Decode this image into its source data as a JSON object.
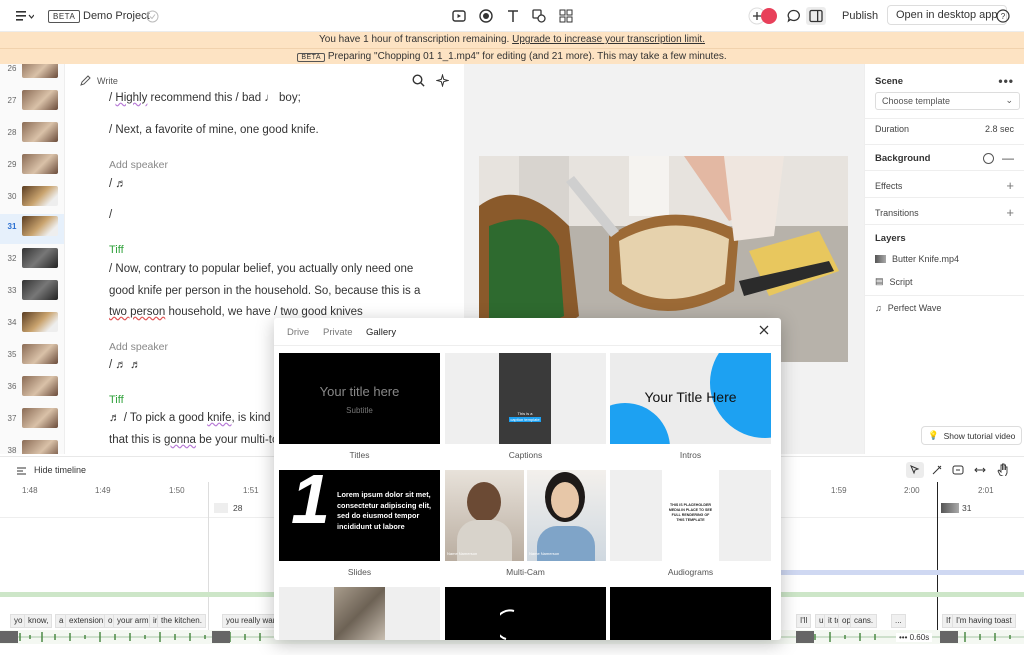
{
  "topbar": {
    "badge": "BETA",
    "project_name": "Demo Project",
    "publish": "Publish",
    "open_desktop": "Open in desktop app",
    "help": "?"
  },
  "banner1": {
    "text": "You have 1 hour of transcription remaining.",
    "link": "Upgrade to increase your transcription limit."
  },
  "banner2": {
    "badge": "BETA",
    "text": "Preparing \"Chopping 01 1_1.mp4\" for editing (and 21 more). This may take a few minutes."
  },
  "thumbs": [
    "26",
    "27",
    "28",
    "29",
    "30",
    "31",
    "32",
    "33",
    "34",
    "35",
    "36",
    "37",
    "38"
  ],
  "thumbs_active": "31",
  "transcript": {
    "write": "Write",
    "lines": {
      "l1_a": "/ ",
      "l1_b": "Highly",
      "l1_c": " recommend this / bad ♩ boy;",
      "l2": "/ Next, a favorite of mine, one good knife.",
      "add_speaker_1": "Add speaker",
      "l3": "/ ♬",
      "l4": "/",
      "speaker_tiff_1": "Tiff",
      "l5": "/ Now, contrary to popular belief, you actually only need one",
      "l6": "good knife per person in the household. So, because this is a",
      "l7_a": "two person",
      "l7_b": " household, we have / two good knives",
      "add_speaker_2": "Add speaker",
      "l8": "/ ♬  ♬",
      "speaker_tiff_2": "Tiff",
      "l9_a": "♬   / To pick a good ",
      "l9_b": "knife",
      "l9_c": ", is kind",
      "l10_a": "that this is ",
      "l10_b": "gonna",
      "l10_c": " be your multi-to"
    }
  },
  "props": {
    "scene": "Scene",
    "choose_template": "Choose template",
    "duration_label": "Duration",
    "duration_value": "2.8 sec",
    "background": "Background",
    "effects": "Effects",
    "transitions": "Transitions",
    "layers": "Layers",
    "layer1": "Butter Knife.mp4",
    "layer2": "Script",
    "layer3": "Perfect Wave",
    "tutorial": "Show tutorial video"
  },
  "timeline": {
    "hide": "Hide timeline",
    "ticks": [
      "1:48",
      "1:49",
      "1:50",
      "1:51",
      "1:59",
      "2:00",
      "2:01"
    ],
    "clip_28": "28",
    "clip_31": "31",
    "zoom": "0.60s",
    "words_left": [
      "yo",
      "know,",
      "a",
      "extension",
      "o",
      "your arm",
      "in",
      "the kitchen.",
      "you really wan"
    ],
    "words_right": [
      "I'll",
      "u",
      "it to",
      "op",
      "cans.",
      "...",
      "If",
      "I'm having toast"
    ]
  },
  "modal": {
    "tabs": [
      "Drive",
      "Private",
      "Gallery"
    ],
    "active_tab": "Gallery",
    "cards": {
      "titles": {
        "label": "Titles",
        "main": "Your title here",
        "sub": "Subtitle"
      },
      "captions": {
        "label": "Captions",
        "line1": "This is a",
        "line2": "caption template"
      },
      "intros": {
        "label": "Intros",
        "main": "Your Title Here"
      },
      "slides": {
        "label": "Slides",
        "num": "1",
        "text": "Lorem ipsum dolor sit met, consectetur adipiscing elit, sed do eiusmod tempor incididunt ut labore"
      },
      "multicam": {
        "label": "Multi-Cam",
        "name1": "Name Namerson",
        "name2": "Name Namerson"
      },
      "audiograms": {
        "label": "Audiograms",
        "text": "THIS IS PLACEHOLDER MEDIA IN PLACE TO SEE FULL RENDERING OF THIS TEMPLATE"
      }
    }
  },
  "colors": {
    "banner": "#fde3c3",
    "accent_blue": "#1da1f2",
    "speaker_green": "#2fa13a",
    "active_thumb": "#e6f0fb"
  }
}
